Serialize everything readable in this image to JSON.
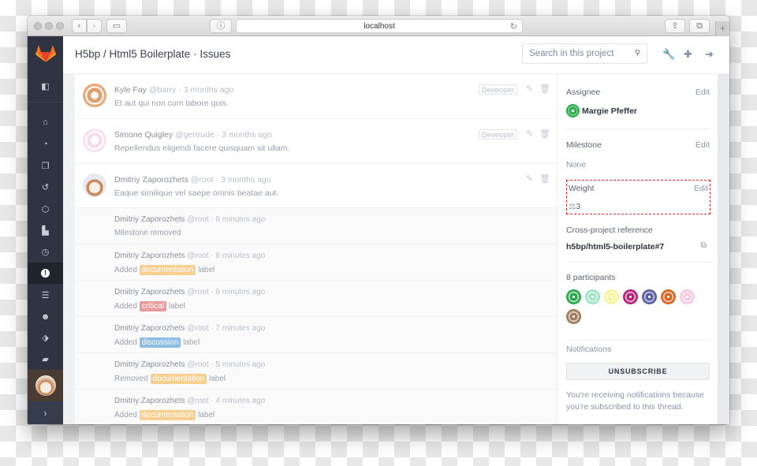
{
  "browser": {
    "url": "localhost",
    "back_icon": "‹",
    "forward_icon": "›",
    "reload_icon": "↻",
    "share_icon": "⇪",
    "tabs_icon": "⧉",
    "new_tab_icon": "+",
    "info_icon": "ⓘ",
    "sidebar_icon": "▭"
  },
  "sidebar": {
    "logo": "gitlab-logo",
    "items": [
      {
        "name": "collapse",
        "icon": "◧"
      },
      {
        "name": "home",
        "icon": "⌂"
      },
      {
        "name": "dashboard",
        "icon": "◔"
      },
      {
        "name": "files",
        "icon": "❐"
      },
      {
        "name": "history",
        "icon": "↺"
      },
      {
        "name": "network",
        "icon": "⬡"
      },
      {
        "name": "graphs",
        "icon": "▙"
      },
      {
        "name": "milestones",
        "icon": "◷"
      },
      {
        "name": "issues",
        "icon": "!"
      },
      {
        "name": "merge-requests",
        "icon": "☰"
      },
      {
        "name": "members",
        "icon": "☻"
      },
      {
        "name": "labels",
        "icon": "⬗"
      },
      {
        "name": "wiki",
        "icon": "▰"
      }
    ],
    "expand_icon": "›"
  },
  "header": {
    "title": "H5bp / Html5 Boilerplate · Issues",
    "search_placeholder": "Search in this project",
    "search_icon": "⚲",
    "admin_icon": "🔧",
    "new_icon": "✚",
    "logout_icon": "➜"
  },
  "colors": {
    "sidebar_bg": "#2e3441",
    "label_documentation": "#f7cf8f",
    "label_critical": "#e99b9b",
    "label_discussion": "#8ebde4",
    "weight_highlight": "#e3242b"
  },
  "notes": [
    {
      "author": "Kyle Fay",
      "meta": "@barry · 3 months ago",
      "body": "Et aut qui non cum labore quis.",
      "role": "Developer"
    },
    {
      "author": "Simone Quigley",
      "meta": "@gertrude · 3 months ago",
      "body": "Repellendus eligendi facere quisquam sit ullam.",
      "role": "Developer"
    },
    {
      "author": "Dmitriy Zaporozhets",
      "meta": "@root · 3 months ago",
      "body": "Eaque similique vel saepe omnis beatae aut.",
      "role": ""
    }
  ],
  "note_actions": {
    "edit_icon": "✎",
    "delete_icon": "🗑"
  },
  "system_notes": [
    {
      "author": "Dmitriy Zaporozhets",
      "meta": "@root · 8 minutes ago",
      "prefix": "Milestone removed",
      "label": "",
      "suffix": ""
    },
    {
      "author": "Dmitriy Zaporozhets",
      "meta": "@root · 8 minutes ago",
      "prefix": "Added",
      "label": "documentation",
      "suffix": "label"
    },
    {
      "author": "Dmitriy Zaporozhets",
      "meta": "@root · 8 minutes ago",
      "prefix": "Added",
      "label": "critical",
      "suffix": "label"
    },
    {
      "author": "Dmitriy Zaporozhets",
      "meta": "@root · 7 minutes ago",
      "prefix": "Added",
      "label": "discussion",
      "suffix": "label"
    },
    {
      "author": "Dmitriy Zaporozhets",
      "meta": "@root · 5 minutes ago",
      "prefix": "Removed",
      "label": "documentation",
      "suffix": "label"
    },
    {
      "author": "Dmitriy Zaporozhets",
      "meta": "@root · 4 minutes ago",
      "prefix": "Added",
      "label": "documentation",
      "suffix": "label"
    }
  ],
  "right_sidebar": {
    "assignee_label": "Assignee",
    "assignee_name": "Margie Pfeffer",
    "edit_label": "Edit",
    "milestone_label": "Milestone",
    "milestone_value": "None",
    "weight_label": "Weight",
    "weight_icon": "⚖",
    "weight_value": "3",
    "reference_label": "Cross-project reference",
    "reference_value": "h5bp/html5-boilerplate#7",
    "copy_icon": "⧉",
    "participants_label": "8 participants",
    "participant_colors": [
      "#2aa84a",
      "#9fe3c4",
      "#f6f59a",
      "#b5247a",
      "#5a5fa0",
      "#d9661f",
      "#f5c9e3",
      "#a07a5a"
    ],
    "notifications_label": "Notifications",
    "unsubscribe_label": "UNSUBSCRIBE",
    "notifications_text_1": "You're receiving notifications because",
    "notifications_text_2": "you're subscribed to this thread."
  }
}
